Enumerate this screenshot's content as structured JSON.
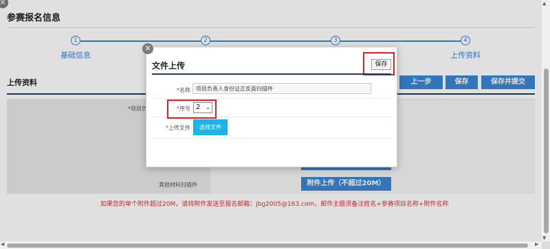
{
  "page": {
    "title": "参赛报名信息",
    "close_glyph": "✕"
  },
  "steps": [
    {
      "num": "1",
      "label": "基础信息"
    },
    {
      "num": "2",
      "label": ""
    },
    {
      "num": "3",
      "label": ""
    },
    {
      "num": "4",
      "label": "上传资料"
    }
  ],
  "section": {
    "title": "上传资料"
  },
  "actions": {
    "prev": "上一步",
    "save": "保存",
    "save_submit": "保存并提交"
  },
  "form": {
    "left_label_1": "*项目负",
    "other_label": "其他材料扫描件",
    "upload_label": "附件上传（不超过20M）",
    "note": "如果您的单个附件超过20M，请将附件发送至报名邮箱：jbg2005@163.com，邮件主题须备注姓名+参赛项目名称+附件名称"
  },
  "modal": {
    "title": "文件上传",
    "save_label": "保存",
    "close_glyph": "✕",
    "name_label": "名称",
    "name_value": "项目负责人身份证正反面扫描件",
    "seq_label": "序号",
    "seq_value": "2",
    "upload_label": "上传文件",
    "choose_label": "选择文件",
    "required_mark": "*"
  },
  "colors": {
    "accent": "#3a86d2",
    "dark_rule": "#253a55",
    "highlight": "#e02020",
    "cyan_button": "#1eb3e8",
    "note_red": "#d33"
  }
}
